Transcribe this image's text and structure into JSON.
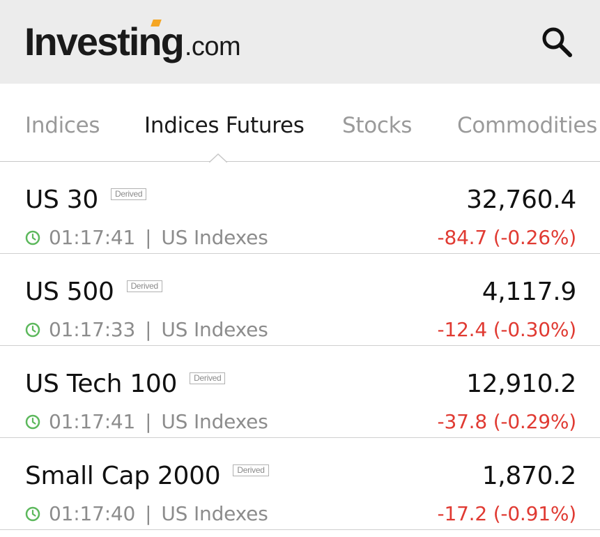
{
  "header": {
    "logo_main": "Investing",
    "logo_suffix": ".com",
    "search_icon": "search-icon",
    "accent_color": "#f5a623"
  },
  "tabs": [
    {
      "label": "Indices",
      "active": false
    },
    {
      "label": "Indices Futures",
      "active": true
    },
    {
      "label": "Stocks",
      "active": false
    },
    {
      "label": "Commodities",
      "active": false
    }
  ],
  "rows": [
    {
      "name": "US 30",
      "badge": "Derived",
      "price": "32,760.4",
      "time": "01:17:41",
      "separator": "|",
      "category": "US Indexes",
      "change": "-84.7 (-0.26%)"
    },
    {
      "name": "US 500",
      "badge": "Derived",
      "price": "4,117.9",
      "time": "01:17:33",
      "separator": "|",
      "category": "US Indexes",
      "change": "-12.4 (-0.30%)"
    },
    {
      "name": "US Tech 100",
      "badge": "Derived",
      "price": "12,910.2",
      "time": "01:17:41",
      "separator": "|",
      "category": "US Indexes",
      "change": "-37.8 (-0.29%)"
    },
    {
      "name": "Small Cap 2000",
      "badge": "Derived",
      "price": "1,870.2",
      "time": "01:17:40",
      "separator": "|",
      "category": "US Indexes",
      "change": "-17.2 (-0.91%)"
    }
  ],
  "colors": {
    "negative": "#e03a32",
    "clock": "#5cb85c",
    "header_bg": "#ececec"
  }
}
